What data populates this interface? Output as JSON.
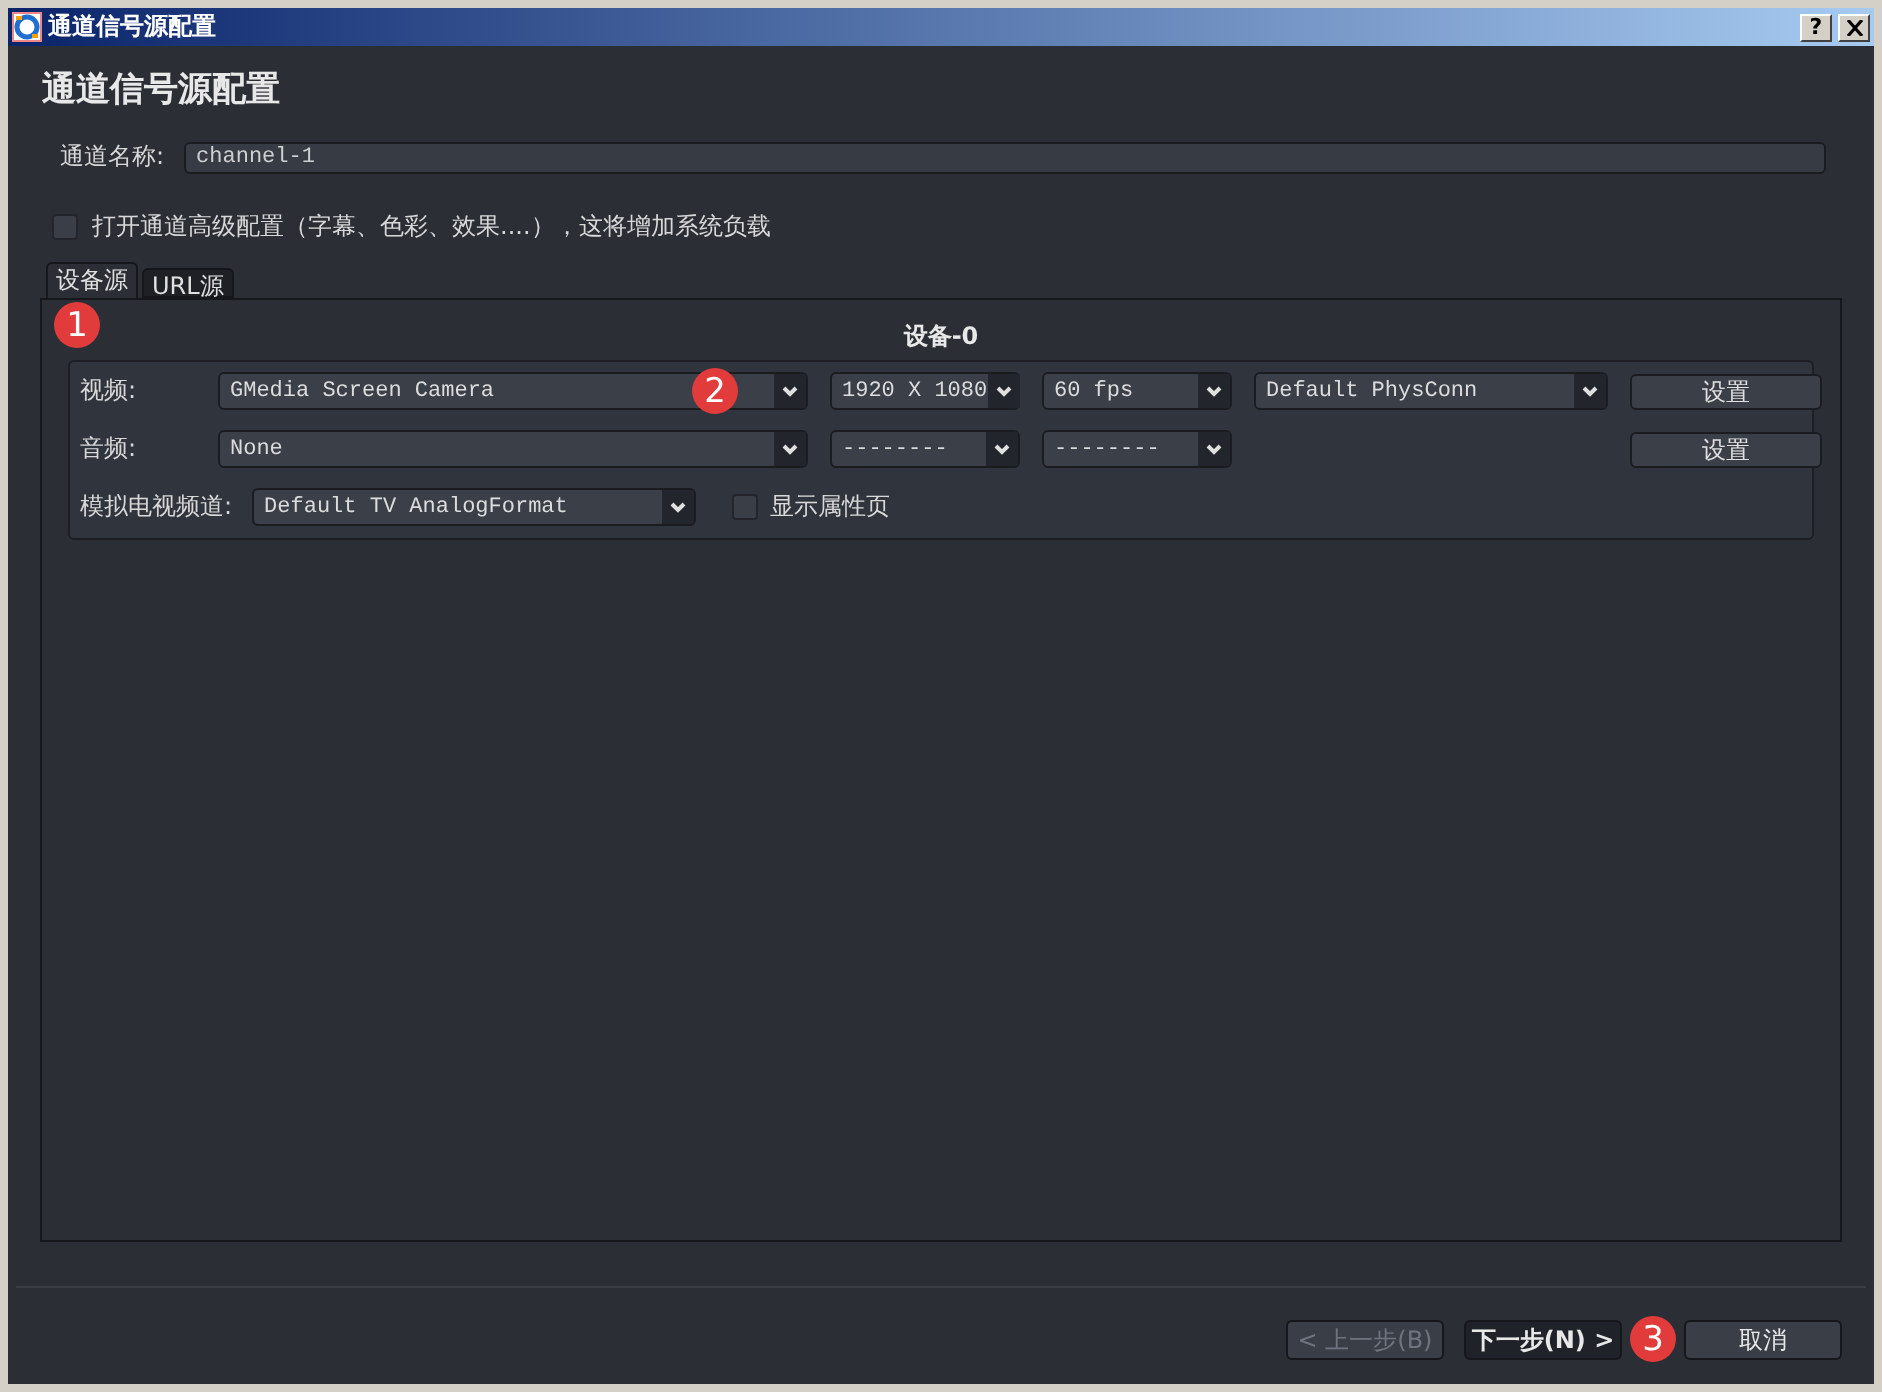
{
  "window": {
    "title": "通道信号源配置",
    "help": "?"
  },
  "heading": "通道信号源配置",
  "channel_name": {
    "label": "通道名称:",
    "value": "channel-1"
  },
  "advanced": {
    "label": "打开通道高级配置（字幕、色彩、效果....），这将增加系统负载",
    "checked": false
  },
  "tabs": [
    {
      "label": "设备源",
      "selected": true
    },
    {
      "label": "URL源",
      "selected": false
    }
  ],
  "device_group": {
    "title": "设备-0",
    "rows": [
      {
        "kind": "combos",
        "label": "视频:",
        "combos": [
          "GMedia Screen Camera",
          "1920 X 1080",
          "60 fps",
          "Default PhysConn"
        ],
        "button": "设置"
      },
      {
        "kind": "combos",
        "label": "音频:",
        "combos": [
          "None",
          "--------",
          "--------"
        ],
        "button": "设置"
      },
      {
        "kind": "analog",
        "label": "模拟电视频道:",
        "combo": "Default TV AnalogFormat",
        "checkbox": {
          "label": "显示属性页",
          "checked": false
        }
      }
    ]
  },
  "footer_buttons": [
    {
      "label": "< 上一步(B)",
      "disabled": true,
      "focused": false
    },
    {
      "label": "下一步(N) >",
      "disabled": false,
      "focused": true
    },
    {
      "label": "取消",
      "disabled": false,
      "focused": false
    }
  ],
  "callouts": [
    "1",
    "2",
    "3"
  ]
}
